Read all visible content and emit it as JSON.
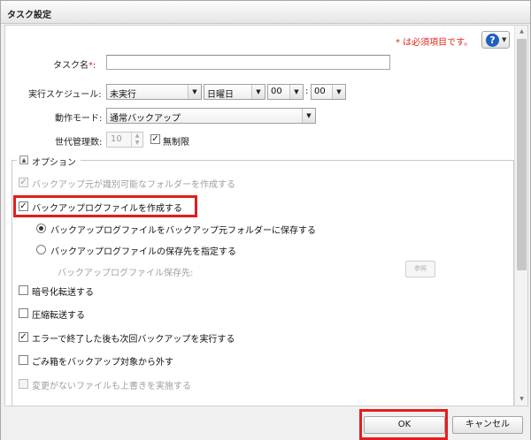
{
  "dialog": {
    "title": "タスク設定"
  },
  "header": {
    "required_note": "* は必須項目です。",
    "help_icon": "question-icon",
    "help_glyph": "?"
  },
  "form": {
    "task_name": {
      "label": "タスク名",
      "required_mark": "*",
      "colon": ":",
      "value": ""
    },
    "schedule": {
      "label": "実行スケジュール:",
      "frequency": "未実行",
      "weekday": "日曜日",
      "hour": "00",
      "time_colon": ":",
      "minute": "00"
    },
    "mode": {
      "label": "動作モード:",
      "value": "通常バックアップ"
    },
    "generations": {
      "label": "世代管理数:",
      "value": "10",
      "unlimited_label": "無制限",
      "unlimited_checked": true
    }
  },
  "options": {
    "legend": "オプション",
    "items": {
      "per_source_folder": {
        "label": "バックアップ元が識別可能なフォルダーを作成する",
        "checked": true,
        "disabled": true
      },
      "create_log": {
        "label": "バックアップログファイルを作成する",
        "checked": true
      },
      "log_to_source": {
        "label": "バックアップログファイルをバックアップ元フォルダーに保存する",
        "selected": true
      },
      "log_specify_dest": {
        "label": "バックアップログファイルの保存先を指定する",
        "selected": false
      },
      "log_dest_label": "バックアップログファイル保存先:",
      "browse_label": "参照",
      "encrypt": {
        "label": "暗号化転送する",
        "checked": false
      },
      "compress": {
        "label": "圧縮転送する",
        "checked": false
      },
      "continue_on_error": {
        "label": "エラーで終了した後も次回バックアップを実行する",
        "checked": true
      },
      "exclude_trash": {
        "label": "ごみ箱をバックアップ対象から外す",
        "checked": false
      },
      "overwrite_unchanged": {
        "label": "変更がないファイルも上書きを実施する",
        "checked": false,
        "disabled": true
      }
    }
  },
  "footer": {
    "ok_label": "OK",
    "cancel_label": "キャンセル"
  },
  "glyphs": {
    "check": "✓",
    "dropdown": "▼",
    "spin_up": "▲",
    "spin_down": "▼",
    "collapse": "▲"
  },
  "colors": {
    "required": "#e0261b",
    "highlight": "#e41d1d",
    "help": "#1f5fbf"
  }
}
